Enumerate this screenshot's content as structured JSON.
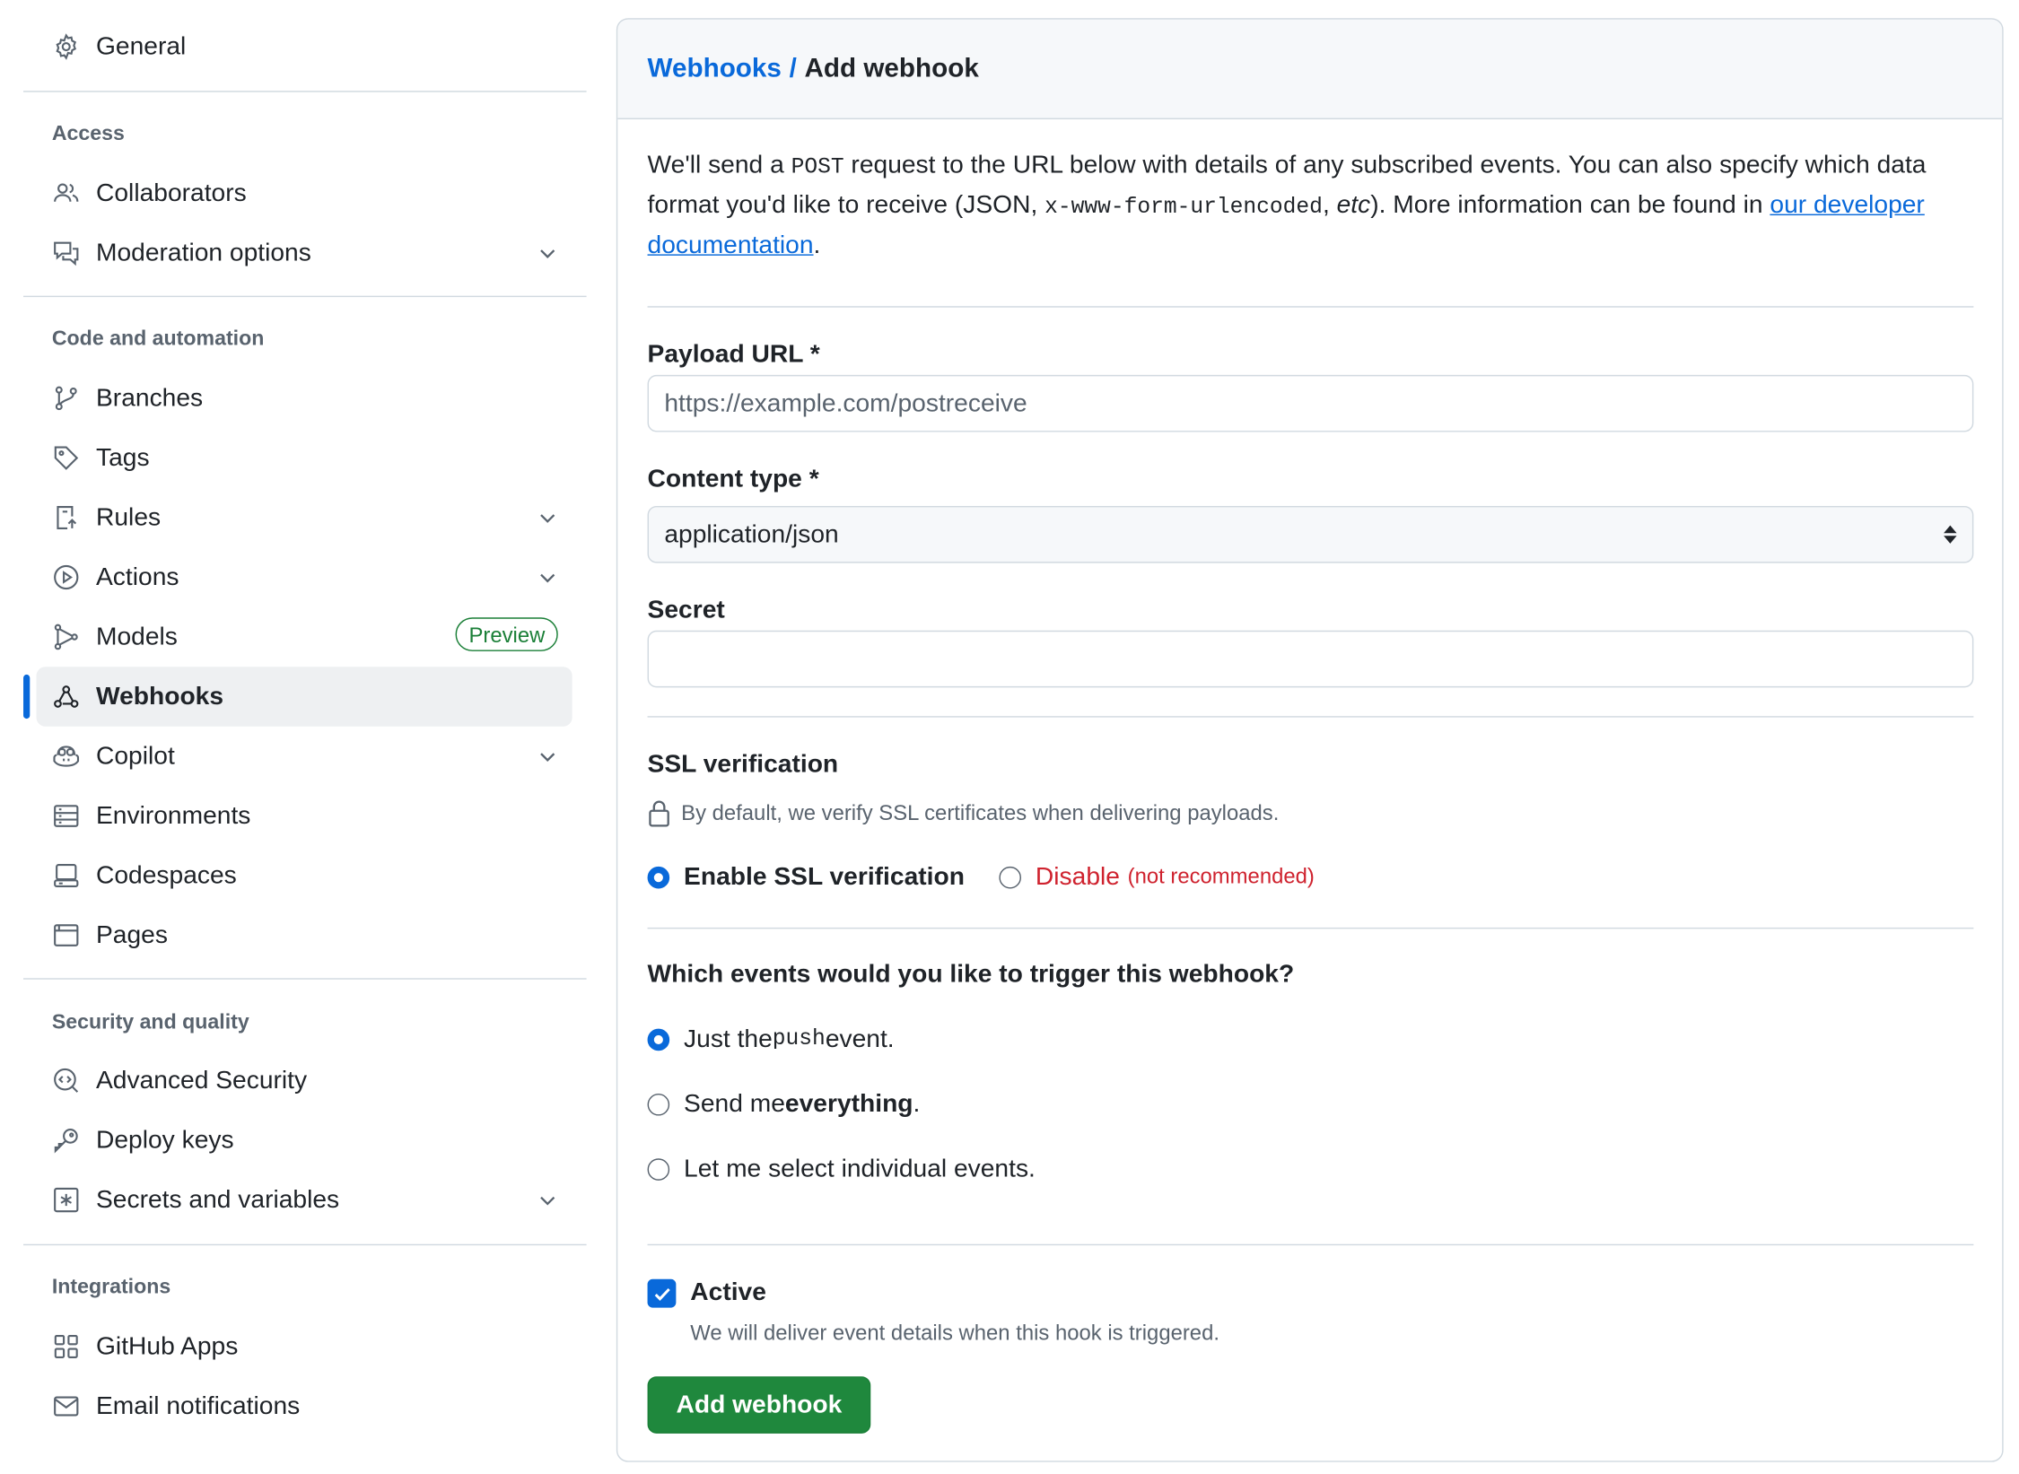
{
  "sidebar": {
    "general": "General",
    "access": {
      "heading": "Access",
      "items": [
        "Collaborators",
        "Moderation options"
      ]
    },
    "code": {
      "heading": "Code and automation",
      "items": [
        "Branches",
        "Tags",
        "Rules",
        "Actions",
        "Models",
        "Webhooks",
        "Copilot",
        "Environments",
        "Codespaces",
        "Pages"
      ],
      "models_badge": "Preview"
    },
    "security": {
      "heading": "Security and quality",
      "items": [
        "Advanced Security",
        "Deploy keys",
        "Secrets and variables"
      ]
    },
    "integrations": {
      "heading": "Integrations",
      "items": [
        "GitHub Apps",
        "Email notifications"
      ]
    }
  },
  "header": {
    "breadcrumb_link": "Webhooks",
    "breadcrumb_sep": "/",
    "title": "Add webhook"
  },
  "intro": {
    "t1": "We'll send a ",
    "code1": "POST",
    "t2": " request to the URL below with details of any subscribed events. You can also specify which data format you'd like to receive (JSON, ",
    "code2": "x-www-form-urlencoded",
    "t3": ", ",
    "etc": "etc",
    "t4": "). More information can be found in ",
    "link": "our developer documentation",
    "t5": "."
  },
  "form": {
    "payload_label": "Payload URL *",
    "payload_placeholder": "https://example.com/postreceive",
    "content_type_label": "Content type *",
    "content_type_value": "application/json",
    "secret_label": "Secret",
    "secret_value": "",
    "ssl_heading": "SSL verification",
    "ssl_note": "By default, we verify SSL certificates when delivering payloads.",
    "ssl_enable": "Enable SSL verification",
    "ssl_disable": "Disable",
    "ssl_disable_note": "(not recommended)",
    "events_heading": "Which events would you like to trigger this webhook?",
    "event_push_pre": "Just the ",
    "event_push_code": "push",
    "event_push_post": " event.",
    "event_all_pre": "Send me ",
    "event_all_bold": "everything",
    "event_all_post": ".",
    "event_select": "Let me select individual events.",
    "active_label": "Active",
    "active_note": "We will deliver event details when this hook is triggered.",
    "submit": "Add webhook"
  },
  "colors": {
    "accent": "#0969da",
    "success": "#1f883d",
    "danger": "#cf222e"
  },
  "icons": {
    "general": "gear-icon",
    "collaborators": "people-icon",
    "moderation": "comment-discussion-icon",
    "branches": "git-branch-icon",
    "tags": "tag-icon",
    "rules": "repo-push-icon",
    "actions": "play-icon",
    "models": "ai-model-icon",
    "webhooks": "webhook-icon",
    "copilot": "copilot-icon",
    "environments": "server-icon",
    "codespaces": "codespaces-icon",
    "pages": "browser-icon",
    "advanced_security": "codescan-icon",
    "deploy_keys": "key-icon",
    "secrets": "key-asterisk-icon",
    "github_apps": "apps-icon",
    "email": "mail-icon"
  }
}
